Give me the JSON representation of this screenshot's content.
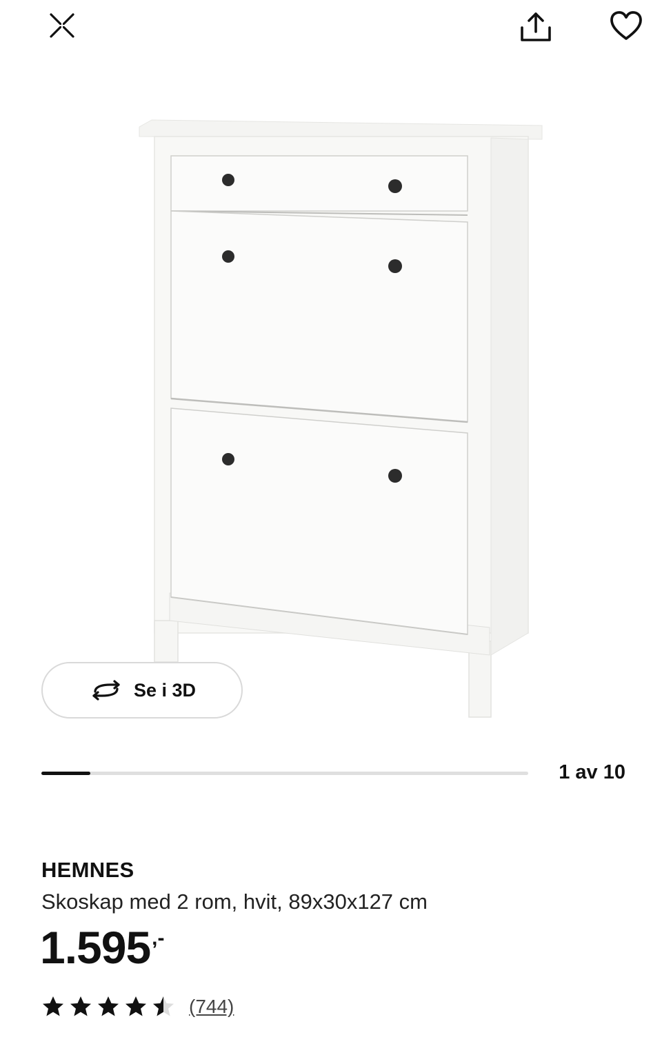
{
  "header": {
    "close_icon": "close-x-icon",
    "share_icon": "share-upload-icon",
    "favorite_icon": "heart-outline-icon"
  },
  "gallery": {
    "view3d_label": "Se i 3D",
    "view3d_icon": "rotate-arrows-icon",
    "current_index": 1,
    "total": 10,
    "counter_text": "1 av 10",
    "progress_fraction": 0.1
  },
  "product": {
    "brand": "HEMNES",
    "description": "Skoskap med 2 rom, hvit, 89x30x127 cm",
    "price": "1.595",
    "price_suffix": ",-",
    "rating": 4.5,
    "rating_max": 5,
    "review_count_text": "(744)"
  },
  "colors": {
    "text": "#111111",
    "progress_track": "#dfdfdf",
    "progress_fill": "#111111",
    "star": "#111111",
    "star_empty": "#dddddd"
  }
}
